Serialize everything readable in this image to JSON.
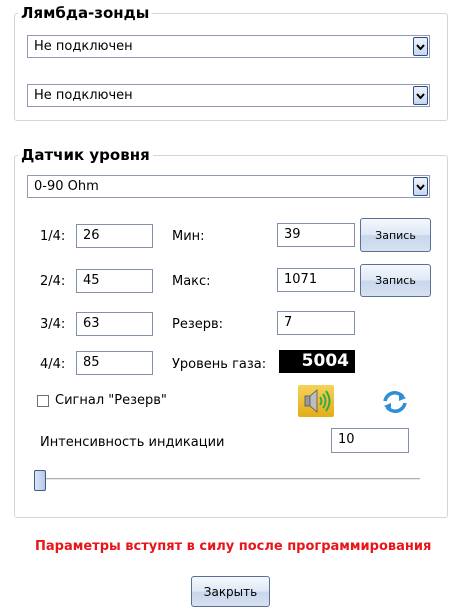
{
  "lambda": {
    "title": "Лямбда-зонды",
    "sensor1": "Не подключен",
    "sensor2": "Не подключен"
  },
  "level": {
    "title": "Датчик уровня",
    "type": "0-90 Ohm",
    "q1_label": "1/4:",
    "q1_value": "26",
    "q2_label": "2/4:",
    "q2_value": "45",
    "q3_label": "3/4:",
    "q3_value": "63",
    "q4_label": "4/4:",
    "q4_value": "85",
    "min_label": "Мин:",
    "min_value": "39",
    "max_label": "Макс:",
    "max_value": "1071",
    "reserve_label": "Резерв:",
    "reserve_value": "7",
    "gas_label": "Уровень газа:",
    "gas_value": "5004",
    "record_label": "Запись",
    "reserve_signal_label": "Сигнал \"Резерв\"",
    "reserve_signal_checked": false,
    "intensity_label": "Интенсивность индикации",
    "intensity_value": "10",
    "intensity_slider_level": 0
  },
  "icons": {
    "sound": "speaker-icon",
    "refresh": "refresh-icon"
  },
  "colors": {
    "warning": "#e8161b",
    "accent": "#2f8ed6"
  },
  "warning": "Параметры вступят в силу  после программирования",
  "close_label": "Закрыть"
}
